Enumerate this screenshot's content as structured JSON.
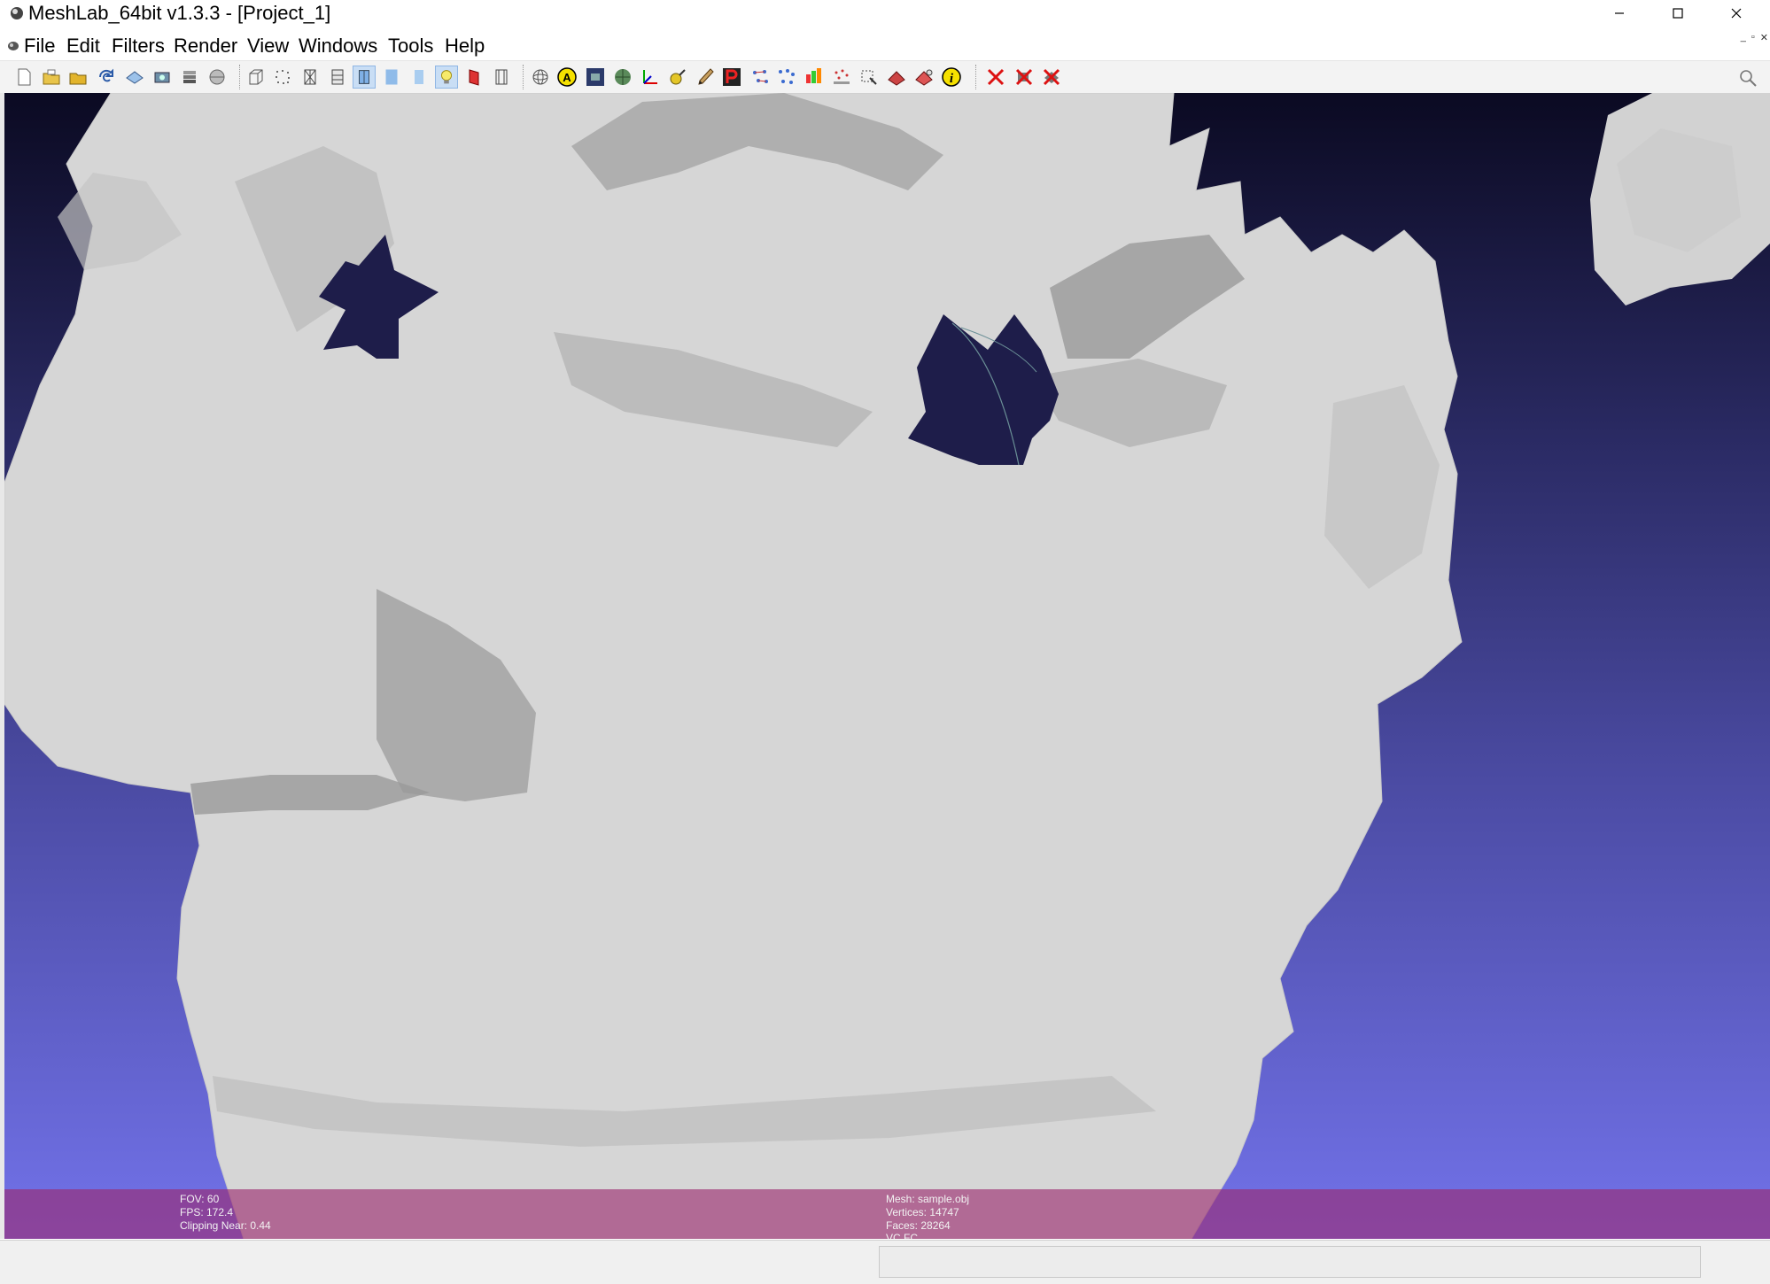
{
  "window": {
    "title": "MeshLab_64bit v1.3.3 - [Project_1]",
    "controls": [
      "minimize",
      "maximize",
      "close"
    ]
  },
  "menu": {
    "items": [
      "File",
      "Edit",
      "Filters",
      "Render",
      "View",
      "Windows",
      "Tools",
      "Help"
    ]
  },
  "toolbar": {
    "icons": [
      "new-project-icon",
      "open-icon",
      "open-project-icon",
      "reload-icon",
      "save-icon",
      "snapshot-icon",
      "layers-icon",
      "import-raster-icon",
      "bounding-box-icon",
      "points-icon",
      "wireframe-icon",
      "hidden-lines-icon",
      "flat-lines-icon",
      "flat-icon",
      "smooth-icon",
      "lighting-icon",
      "double-side-icon",
      "backface-icon",
      "trackball-icon",
      "annotation-icon",
      "raster-icon",
      "texture-icon",
      "axis-icon",
      "select-vertices-icon",
      "paint-icon",
      "color-paint-icon",
      "align-icon",
      "points-pick-icon",
      "quality-map-icon",
      "reference-icon",
      "select-faces-icon",
      "select-connected-icon",
      "measure-icon",
      "info-icon",
      "delete-vertices-icon",
      "delete-faces-icon",
      "delete-faces-vertices-icon"
    ],
    "active": [
      "flat-lines-icon",
      "lighting-icon"
    ],
    "colors": {
      "accent": "#c9def5",
      "yellow": "#f5e000"
    }
  },
  "viewport": {
    "background_top": "#0b0a22",
    "background_bottom": "#7272e9",
    "mesh_color": "#d4d4d4"
  },
  "info_overlay": {
    "left": {
      "fov": "FOV: 60",
      "fps": "FPS:   172.4",
      "clipping": "Clipping Near:   0.44"
    },
    "right": {
      "mesh": "Mesh: sample.obj",
      "vertices": "Vertices: 14747",
      "faces": "Faces: 28264",
      "mode": "VC FC"
    }
  }
}
